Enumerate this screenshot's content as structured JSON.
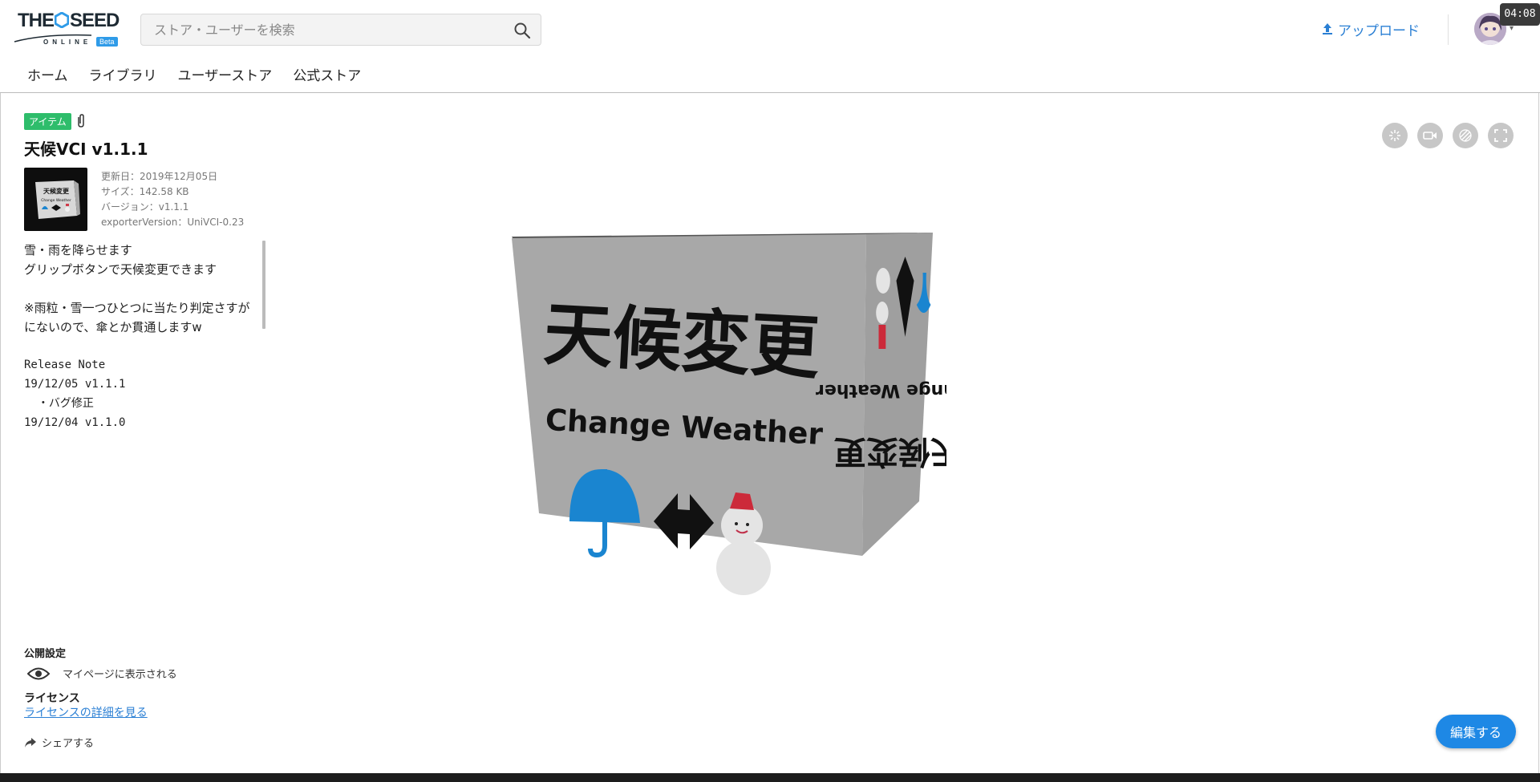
{
  "app": {
    "logo_text_left": "THE",
    "logo_text_right": "SEED",
    "logo_sub": "ONLINE",
    "logo_beta": "Beta"
  },
  "search": {
    "placeholder": "ストア・ユーザーを検索"
  },
  "header": {
    "upload_label": "アップロード",
    "clock": "04:08"
  },
  "nav": {
    "items": [
      {
        "label": "ホーム"
      },
      {
        "label": "ライブラリ"
      },
      {
        "label": "ユーザーストア"
      },
      {
        "label": "公式ストア"
      }
    ]
  },
  "item": {
    "tag": "アイテム",
    "title": "天候VCI v1.1.1",
    "meta": {
      "updated": "更新日：2019年12月05日",
      "size": "サイズ：142.58 KB",
      "version": "バージョン：v1.1.1",
      "exporter": "exporterVersion：UniVCI-0.23"
    },
    "description": "雪・雨を降らせます\nグリップボタンで天候変更できます\n\n※雨粒・雪一つひとつに当たり判定さすがにないので、傘とか貫通しますw",
    "release_note": "Release Note\n19/12/05 v1.1.1\n  ・バグ修正\n19/12/04 v1.1.0",
    "thumb_text": "天候変更",
    "thumb_sub": "Change Weather"
  },
  "cube": {
    "front_title": "天候変更",
    "front_sub": "Change Weather",
    "side_title": "天候変更",
    "side_sub": "Change Weather"
  },
  "publish": {
    "title": "公開設定",
    "visibility": "マイページに表示される"
  },
  "license": {
    "title": "ライセンス",
    "link": "ライセンスの詳細を見る"
  },
  "share_label": "シェアする",
  "edit_label": "編集する",
  "icons": {
    "search": "search-icon",
    "upload": "upload-icon",
    "attachment": "paperclip-icon",
    "eye": "eye-icon",
    "share": "share-arrow-icon",
    "tools": [
      "spinner-icon",
      "video-camera-icon",
      "hatch-pattern-icon",
      "fullscreen-icon"
    ]
  },
  "colors": {
    "accent": "#1e88e5",
    "tag": "#2ebd6b",
    "link": "#2a7fd4",
    "umbrella": "#1a85d0",
    "snowman_hat": "#d03a4a"
  }
}
